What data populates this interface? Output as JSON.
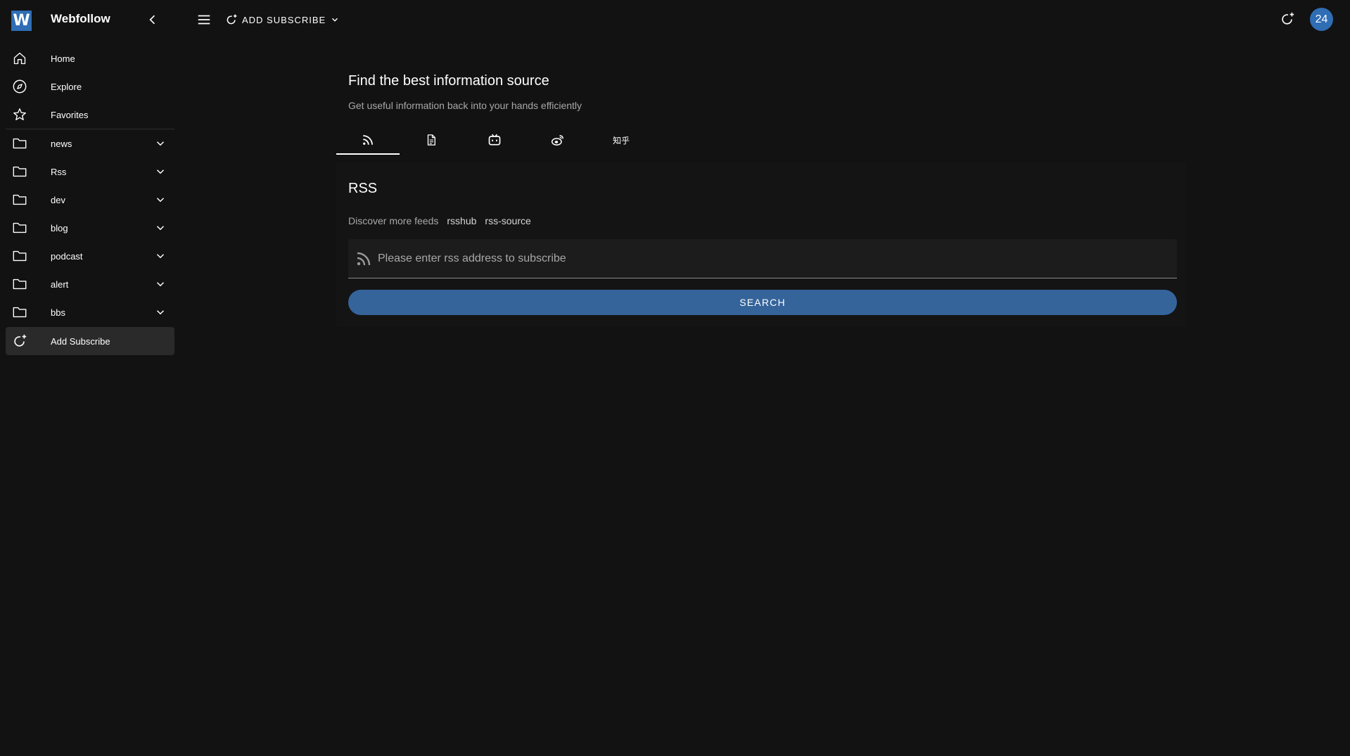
{
  "app": {
    "logo_letter": "W",
    "title": "Webfollow"
  },
  "sidebar": {
    "items": [
      {
        "label": "Home",
        "icon": "home-icon"
      },
      {
        "label": "Explore",
        "icon": "compass-icon"
      },
      {
        "label": "Favorites",
        "icon": "star-icon"
      }
    ],
    "folders": [
      {
        "label": "news"
      },
      {
        "label": "Rss"
      },
      {
        "label": "dev"
      },
      {
        "label": "blog"
      },
      {
        "label": "podcast"
      },
      {
        "label": "alert"
      },
      {
        "label": "bbs"
      }
    ],
    "add_subscribe": "Add Subscribe"
  },
  "topbar": {
    "add_subscribe_label": "ADD SUBSCRIBE",
    "avatar_text": "24"
  },
  "hero": {
    "title": "Find the best information source",
    "subtitle": "Get useful information back into your hands efficiently"
  },
  "tabs": [
    {
      "icon": "rss-icon",
      "active": true
    },
    {
      "icon": "document-icon",
      "active": false
    },
    {
      "icon": "bilibili-icon",
      "active": false
    },
    {
      "icon": "weibo-icon",
      "active": false
    },
    {
      "label": "知乎",
      "active": false
    }
  ],
  "panel": {
    "title": "RSS",
    "discover_label": "Discover more feeds",
    "links": [
      "rsshub",
      "rss-source"
    ],
    "input_placeholder": "Please enter rss address to subscribe",
    "search_label": "SEARCH"
  },
  "colors": {
    "background": "#121212",
    "accent": "#2f6db5",
    "button": "#35649b"
  }
}
